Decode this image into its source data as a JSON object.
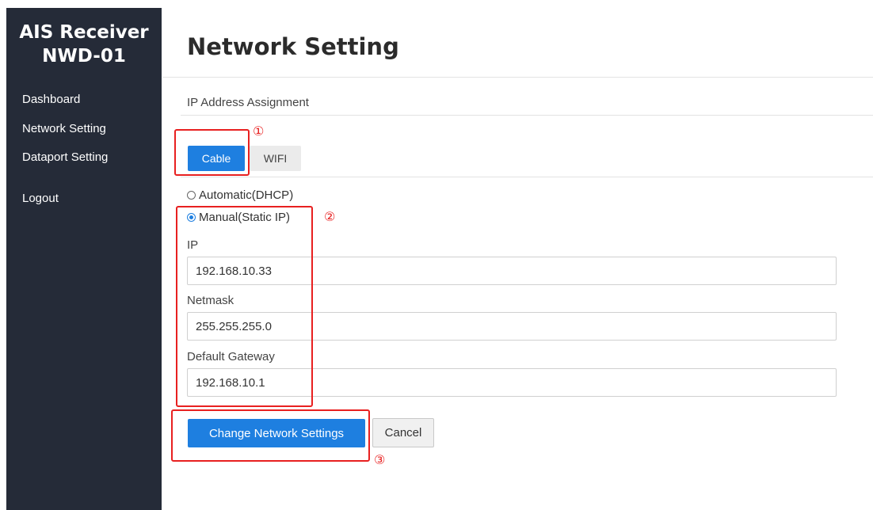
{
  "sidebar": {
    "brand_line1": "AIS Receiver",
    "brand_line2": "NWD-01",
    "items": [
      {
        "label": "Dashboard"
      },
      {
        "label": "Network Setting"
      },
      {
        "label": "Dataport Setting"
      },
      {
        "label": "Logout"
      }
    ]
  },
  "main": {
    "title": "Network Setting",
    "section_label": "IP Address Assignment",
    "tabs": [
      {
        "label": "Cable",
        "active": true
      },
      {
        "label": "WIFI",
        "active": false
      }
    ],
    "mode_options": [
      {
        "label": "Automatic(DHCP)",
        "checked": false
      },
      {
        "label": "Manual(Static IP)",
        "checked": true
      }
    ],
    "fields": {
      "ip": {
        "label": "IP",
        "value": "192.168.10.33"
      },
      "netmask": {
        "label": "Netmask",
        "value": "255.255.255.0"
      },
      "gateway": {
        "label": "Default Gateway",
        "value": "192.168.10.1"
      }
    },
    "buttons": {
      "submit_label": "Change Network Settings",
      "cancel_label": "Cancel"
    }
  },
  "annotations": {
    "step1": "①",
    "step2": "②",
    "step3": "③"
  },
  "colors": {
    "sidebar_bg": "#252b38",
    "accent": "#1e7fe0",
    "annotation": "#e82020"
  }
}
